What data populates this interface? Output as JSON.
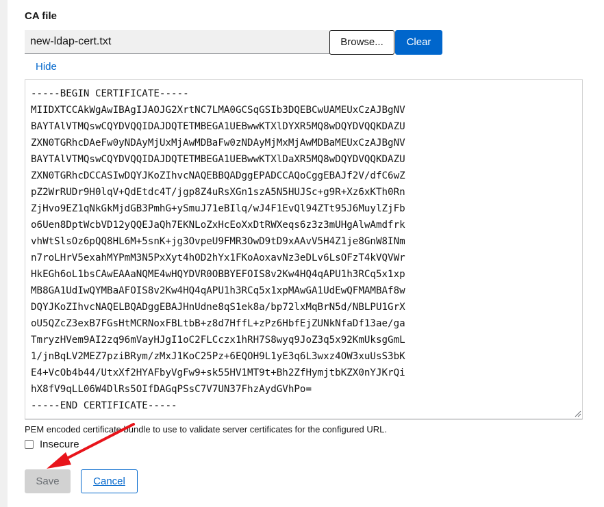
{
  "field": {
    "label": "CA file",
    "filename": "new-ldap-cert.txt",
    "browse_label": "Browse...",
    "clear_label": "Clear",
    "hide_label": "Hide",
    "certificate_lines": [
      "-----BEGIN CERTIFICATE-----",
      "MIIDXTCCAkWgAwIBAgIJAOJG2XrtNC7LMA0GCSqGSIb3DQEBCwUAMEUxCzAJBgNV",
      "BAYTAlVTMQswCQYDVQQIDAJDQTETMBEGA1UEBwwKTXlDYXR5MQ8wDQYDVQQKDAZU",
      "ZXN0TGRhcDAeFw0yNDAyMjUxMjAwMDBaFw0zNDAyMjMxMjAwMDBaMEUxCzAJBgNV",
      "BAYTAlVTMQswCQYDVQQIDAJDQTETMBEGA1UEBwwKTXlDaXR5MQ8wDQYDVQQKDAZU",
      "ZXN0TGRhcDCCASIwDQYJKoZIhvcNAQEBBQADggEPADCCAQoCggEBAJf2V/dfC6wZ",
      "pZ2WrRUDr9H0lqV+QdEtdc4T/jgp8Z4uRsXGn1szA5N5HUJSc+g9R+Xz6xKTh0Rn",
      "ZjHvo9EZ1qNkGkMjdGB3PmhG+ySmuJ71eBIlq/wJ4F1EvQl94ZTt95J6MuylZjFb",
      "o6Uen8DptWcbVD12yQQEJaQh7EKNLoZxHcEoXxDtRWXeqs6z3z3mUHgAlwAmdfrk",
      "vhWtSlsOz6pQQ8HL6M+5snK+jg3OvpeU9FMR3OwD9tD9xAAvV5H4Z1je8GnW8INm",
      "n7roLHrV5exahMYPmM3N5PxXyt4hOD2hYx1FKoAoxavNz3eDLv6LsOFzT4kVQVWr",
      "HkEGh6oL1bsCAwEAAaNQME4wHQYDVR0OBBYEFOIS8v2Kw4HQ4qAPU1h3RCq5x1xp",
      "MB8GA1UdIwQYMBaAFOIS8v2Kw4HQ4qAPU1h3RCq5x1xpMAwGA1UdEwQFMAMBAf8w",
      "DQYJKoZIhvcNAQELBQADggEBAJHnUdne8qS1ek8a/bp72lxMqBrN5d/NBLPU1GrX",
      "oU5QZcZ3exB7FGsHtMCRNoxFBLtbB+z8d7HffL+zPz6HbfEjZUNkNfaDf13ae/ga",
      "TmryzHVem9AI2zq96mVayHJgI1oC2FLCczx1hRH7S8wyq9JoZ3q5x92KmUksgGmL",
      "1/jnBqLV2MEZ7pziBRym/zMxJ1KoC25Pz+6EQOH9L1yE3q6L3wxz4OW3xuUsS3bK",
      "E4+VcOb4b44/UtxXf2HYAFbyVgFw9+sk55HV1MT9t+Bh2ZfHymjtbKZX0nYJKrQi",
      "hX8fV9qLL06W4DlRs5OIfDAGqPSsC7V7UN37FhzAydGVhPo=",
      "-----END CERTIFICATE-----"
    ],
    "helper_text": "PEM encoded certificate bundle to use to validate server certificates for the configured URL."
  },
  "insecure": {
    "label": "Insecure",
    "checked": false
  },
  "actions": {
    "save_label": "Save",
    "cancel_label": "Cancel"
  },
  "colors": {
    "primary": "#0066cc",
    "disabled_bg": "#d2d2d2",
    "arrow": "#e8141b"
  }
}
